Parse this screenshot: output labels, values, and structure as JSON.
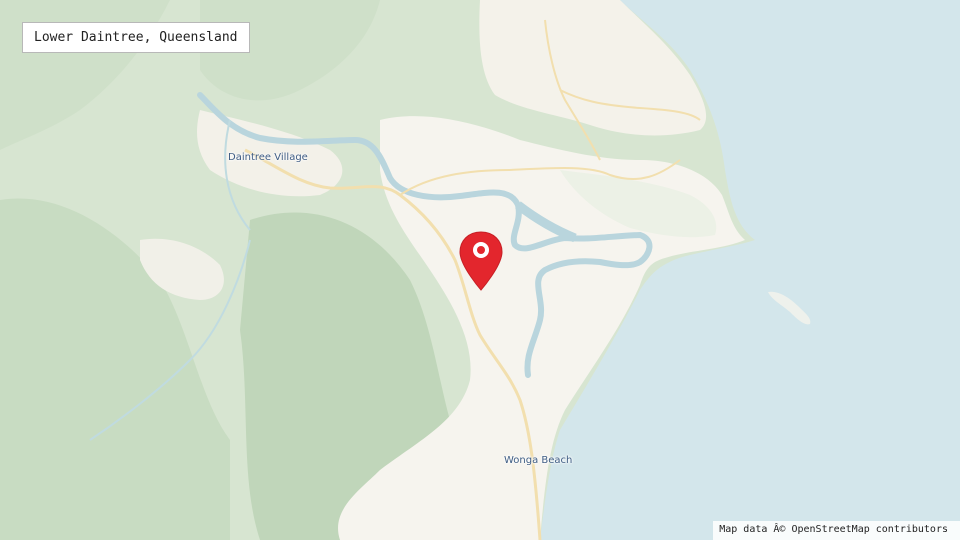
{
  "map": {
    "title": "Lower Daintree, Queensland",
    "places": {
      "daintree_village": "Daintree Village",
      "wonga_beach": "Wonga Beach"
    },
    "attribution": "Map data Â© OpenStreetMap contributors",
    "marker_icon": "map-pin-icon",
    "colors": {
      "sea": "#cfe3ea",
      "forest_dark": "#c3d8bd",
      "forest_light": "#d9e6d3",
      "cleared_land": "#f8f6f0",
      "river": "#b7d3de",
      "road": "#f2dfae",
      "label": "#3f5d84",
      "marker": "#e3262d"
    }
  }
}
